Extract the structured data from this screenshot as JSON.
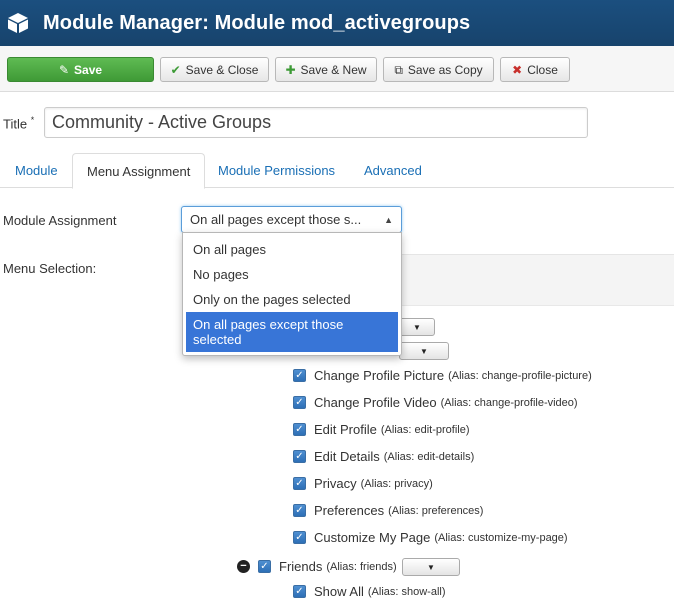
{
  "header": {
    "title": "Module Manager: Module mod_activegroups",
    "icon": "cube-icon"
  },
  "toolbar": {
    "save": "Save",
    "save_close": "Save & Close",
    "save_new": "Save & New",
    "save_copy": "Save as Copy",
    "close": "Close"
  },
  "form": {
    "title_label": "Title",
    "title_required": "*",
    "title_value": "Community - Active Groups"
  },
  "tabs": [
    "Module",
    "Menu Assignment",
    "Module Permissions",
    "Advanced"
  ],
  "assignment": {
    "label": "Module Assignment",
    "selected": "On all pages except those s...",
    "menu_selection_label": "Menu Selection:",
    "options": [
      "On all pages",
      "No pages",
      "Only on the pages selected",
      "On all pages except those selected"
    ]
  },
  "menu_items": [
    {
      "name": "Change Profile Picture",
      "alias": "(Alias: change-profile-picture)"
    },
    {
      "name": "Change Profile Video",
      "alias": "(Alias: change-profile-video)"
    },
    {
      "name": "Edit Profile",
      "alias": "(Alias: edit-profile)"
    },
    {
      "name": "Edit Details",
      "alias": "(Alias: edit-details)"
    },
    {
      "name": "Privacy",
      "alias": "(Alias: privacy)"
    },
    {
      "name": "Preferences",
      "alias": "(Alias: preferences)"
    },
    {
      "name": "Customize My Page",
      "alias": "(Alias: customize-my-page)"
    }
  ],
  "friends": {
    "name": "Friends",
    "alias": "(Alias: friends)"
  },
  "show_all": {
    "name": "Show All",
    "alias": "(Alias: show-all)"
  }
}
